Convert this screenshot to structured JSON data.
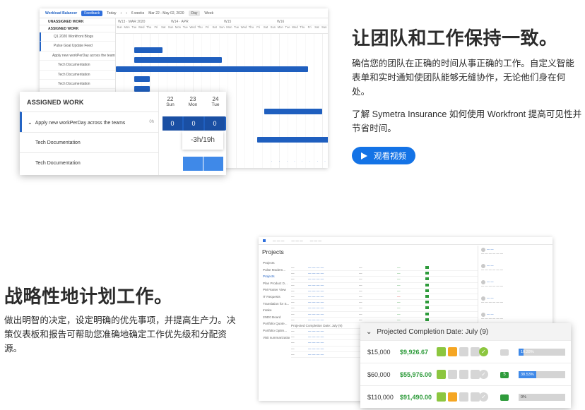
{
  "section1": {
    "title": "让团队和工作保持一致。",
    "paragraph1": "确信您的团队在正确的时间从事正确的工作。自定义智能表单和实时通知使团队能够无缝协作，无论他们身在何处。",
    "paragraph2": "了解 Symetra Insurance 如何使用 Workfront 提高可见性并节省时间。",
    "video_button": "观看视频",
    "screenshot": {
      "toolbar": {
        "view": "Workload Balancer",
        "feedback": "Feedback",
        "today": "Today",
        "range": "6 weeks",
        "dates": "Mar 22 - May 02, 2020",
        "day": "Day",
        "week": "Week"
      },
      "unassigned": "UNASSIGNED WORK",
      "assigned": "ASSIGNED WORK",
      "rows": [
        "Q1 2020 Workfront Blogs",
        "Pulse Goal Update Feed",
        "Apply new workPerDay across the teams",
        "Tech Documentation",
        "Tech Documentation",
        "Tech Documentation"
      ],
      "weeks": [
        "W13 · MAR 2020",
        "W14 · APR",
        "W15",
        "W16"
      ],
      "popup": {
        "title": "ASSIGNED WORK",
        "rows": [
          {
            "label": "Apply new workPerDay across the teams",
            "hours": "0h"
          },
          {
            "label": "Tech Documentation"
          },
          {
            "label": "Tech Documentation"
          }
        ],
        "days": [
          {
            "num": "22",
            "name": "Sun"
          },
          {
            "num": "23",
            "name": "Mon"
          },
          {
            "num": "24",
            "name": "Tue"
          }
        ],
        "cell_values": [
          "0",
          "0",
          "0"
        ],
        "tooltip": "-3h/19h"
      }
    }
  },
  "section2": {
    "title": "战略性地计划工作。",
    "paragraph": "做出明智的决定，设定明确的优先事项，并提高生产力。决策仪表板和报告可帮助您准确地确定工作优先级和分配资源。",
    "screenshot": {
      "page_title": "Projects",
      "nav": [
        "Projects",
        "Pulse Modern...",
        "Projects",
        "Plan Product D...",
        "PM Roster View",
        "IT Requests",
        "Translation for S...",
        "Intake",
        "2ND0 Board",
        "Portfolio Quote...",
        "Portfolio Optim...",
        "Visit summarization"
      ],
      "group_label": "Projected Completion Date: July (9)",
      "card": {
        "title": "Projected Completion Date: July (9)",
        "rows": [
          {
            "budget": "$15,000",
            "actual": "$9,926.67",
            "badge": "",
            "progress": 0.1,
            "pct_label": "10.28%"
          },
          {
            "budget": "$60,000",
            "actual": "$55,976.00",
            "badge": "5",
            "progress": 0.385,
            "pct_label": "38.53%"
          },
          {
            "budget": "$110,000",
            "actual": "$91,490.00",
            "badge": "",
            "progress": 0.0,
            "pct_label": "0%"
          }
        ]
      }
    }
  },
  "colors": {
    "accent": "#1473e6",
    "bar_blue": "#1f5fbf",
    "green": "#2e9b3b",
    "status_green": "#8cc63f",
    "status_orange": "#f5a623"
  }
}
